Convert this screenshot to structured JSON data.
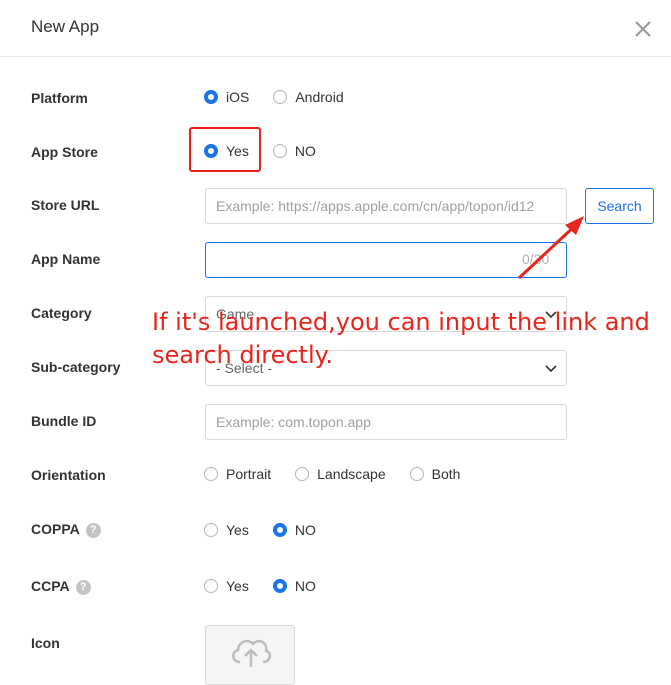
{
  "dialog": {
    "title": "New App"
  },
  "form": {
    "platform": {
      "label": "Platform",
      "options": [
        "iOS",
        "Android"
      ],
      "selected": "iOS"
    },
    "app_store": {
      "label": "App Store",
      "options": [
        "Yes",
        "NO"
      ],
      "selected": "Yes"
    },
    "store_url": {
      "label": "Store URL",
      "placeholder": "Example: https://apps.apple.com/cn/app/topon/id12",
      "search_label": "Search"
    },
    "app_name": {
      "label": "App Name",
      "value": "",
      "counter": "0/30"
    },
    "category": {
      "label": "Category",
      "value": "Game"
    },
    "sub_category": {
      "label": "Sub-category",
      "value": "- Select -"
    },
    "bundle_id": {
      "label": "Bundle ID",
      "placeholder": "Example: com.topon.app"
    },
    "orientation": {
      "label": "Orientation",
      "options": [
        "Portrait",
        "Landscape",
        "Both"
      ],
      "selected": null
    },
    "coppa": {
      "label": "COPPA",
      "help": "?",
      "options": [
        "Yes",
        "NO"
      ],
      "selected": "NO"
    },
    "ccpa": {
      "label": "CCPA",
      "help": "?",
      "options": [
        "Yes",
        "NO"
      ],
      "selected": "NO"
    },
    "icon": {
      "label": "Icon"
    }
  },
  "annotation": {
    "text": "If it's launched,you can input the link and search directly.",
    "color": "#e8251c"
  },
  "colors": {
    "accent": "#1a73e8",
    "annotation": "#e8251c"
  }
}
